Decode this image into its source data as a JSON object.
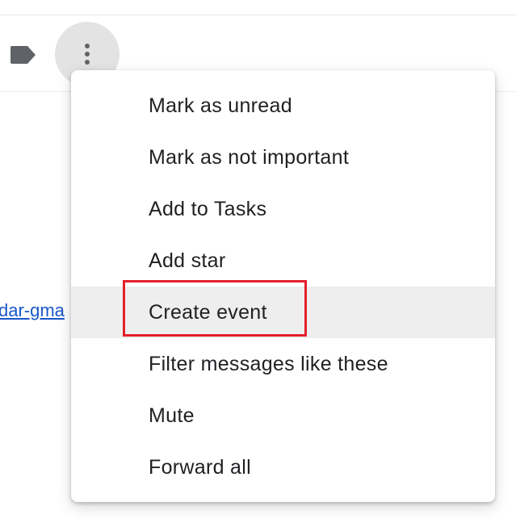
{
  "toolbar": {
    "label_icon": "label-icon",
    "more_icon": "more-vertical-icon"
  },
  "background": {
    "link_text": "dar-gma"
  },
  "menu": {
    "items": [
      {
        "label": "Mark as unread"
      },
      {
        "label": "Mark as not important"
      },
      {
        "label": "Add to Tasks"
      },
      {
        "label": "Add star"
      },
      {
        "label": "Create event",
        "hovered": true,
        "highlighted": true
      },
      {
        "label": "Filter messages like these"
      },
      {
        "label": "Mute"
      },
      {
        "label": "Forward all"
      }
    ]
  },
  "colors": {
    "highlight_border": "#e3202b",
    "hover_background": "#eeeeee",
    "link": "#1a56c9",
    "text": "#202124"
  }
}
